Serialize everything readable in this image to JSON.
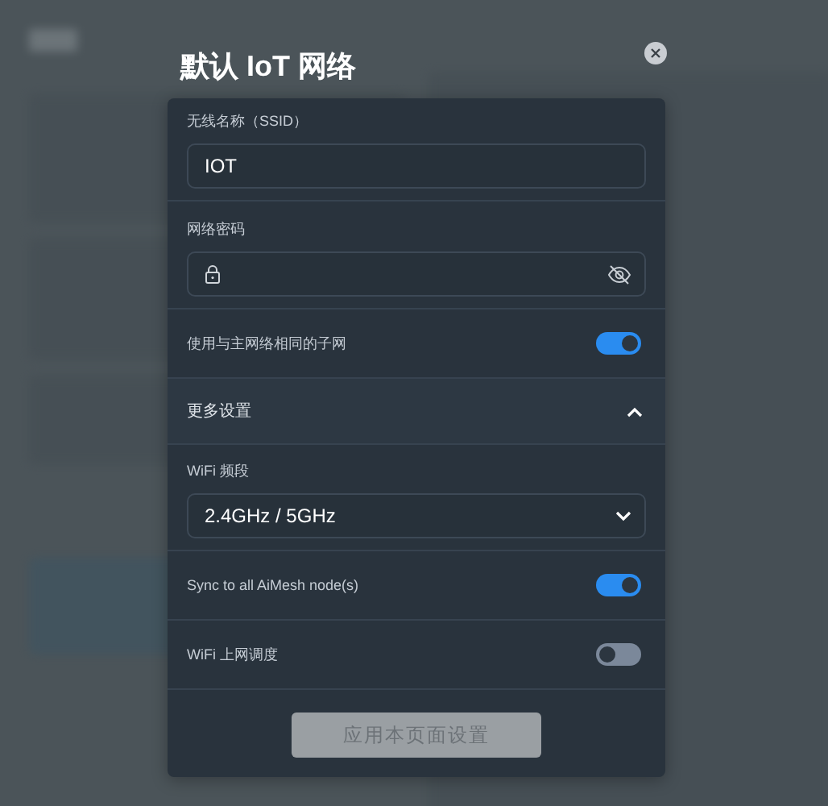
{
  "dialog": {
    "title": "默认 IoT 网络",
    "items": [
      {
        "kind": "text",
        "label": "无线名称（SSID）",
        "value": "IOT"
      },
      {
        "kind": "password",
        "label": "网络密码",
        "masked": true
      },
      {
        "kind": "toggle",
        "label": "使用与主网络相同的子网",
        "on": true
      },
      {
        "kind": "section",
        "label": "更多设置",
        "expanded": true
      },
      {
        "kind": "select",
        "label": "WiFi 频段",
        "value": "2.4GHz / 5GHz"
      },
      {
        "kind": "toggle",
        "label": "Sync to all AiMesh node(s)",
        "on": true
      },
      {
        "kind": "toggle",
        "label": "WiFi 上网调度",
        "on": false
      }
    ],
    "button": {
      "label": "应用本页面设置",
      "disabled": true
    }
  }
}
